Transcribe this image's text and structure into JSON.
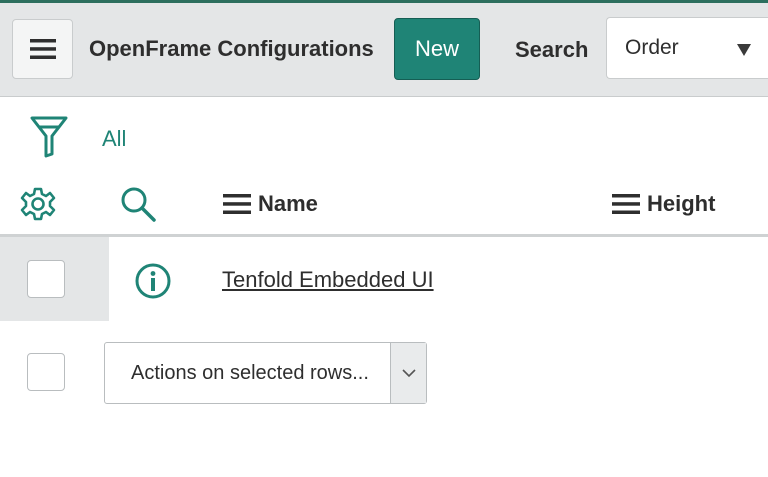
{
  "header": {
    "title": "OpenFrame Configurations",
    "new_label": "New",
    "search_label": "Search",
    "search_field_value": "Order"
  },
  "filter": {
    "all_label": "All"
  },
  "columns": [
    {
      "label": "Name"
    },
    {
      "label": "Height"
    }
  ],
  "rows": [
    {
      "name": "Tenfold Embedded UI",
      "height": ""
    }
  ],
  "footer": {
    "actions_placeholder": "Actions on selected rows..."
  },
  "icons": {
    "menu": "hamburger-icon",
    "filter": "funnel-icon",
    "settings": "gear-icon",
    "search": "magnifier-icon",
    "info": "info-circle-icon",
    "dropdown": "chevron-down-icon"
  },
  "colors": {
    "accent": "#1f8476",
    "header_bg": "#e4e6e7"
  }
}
